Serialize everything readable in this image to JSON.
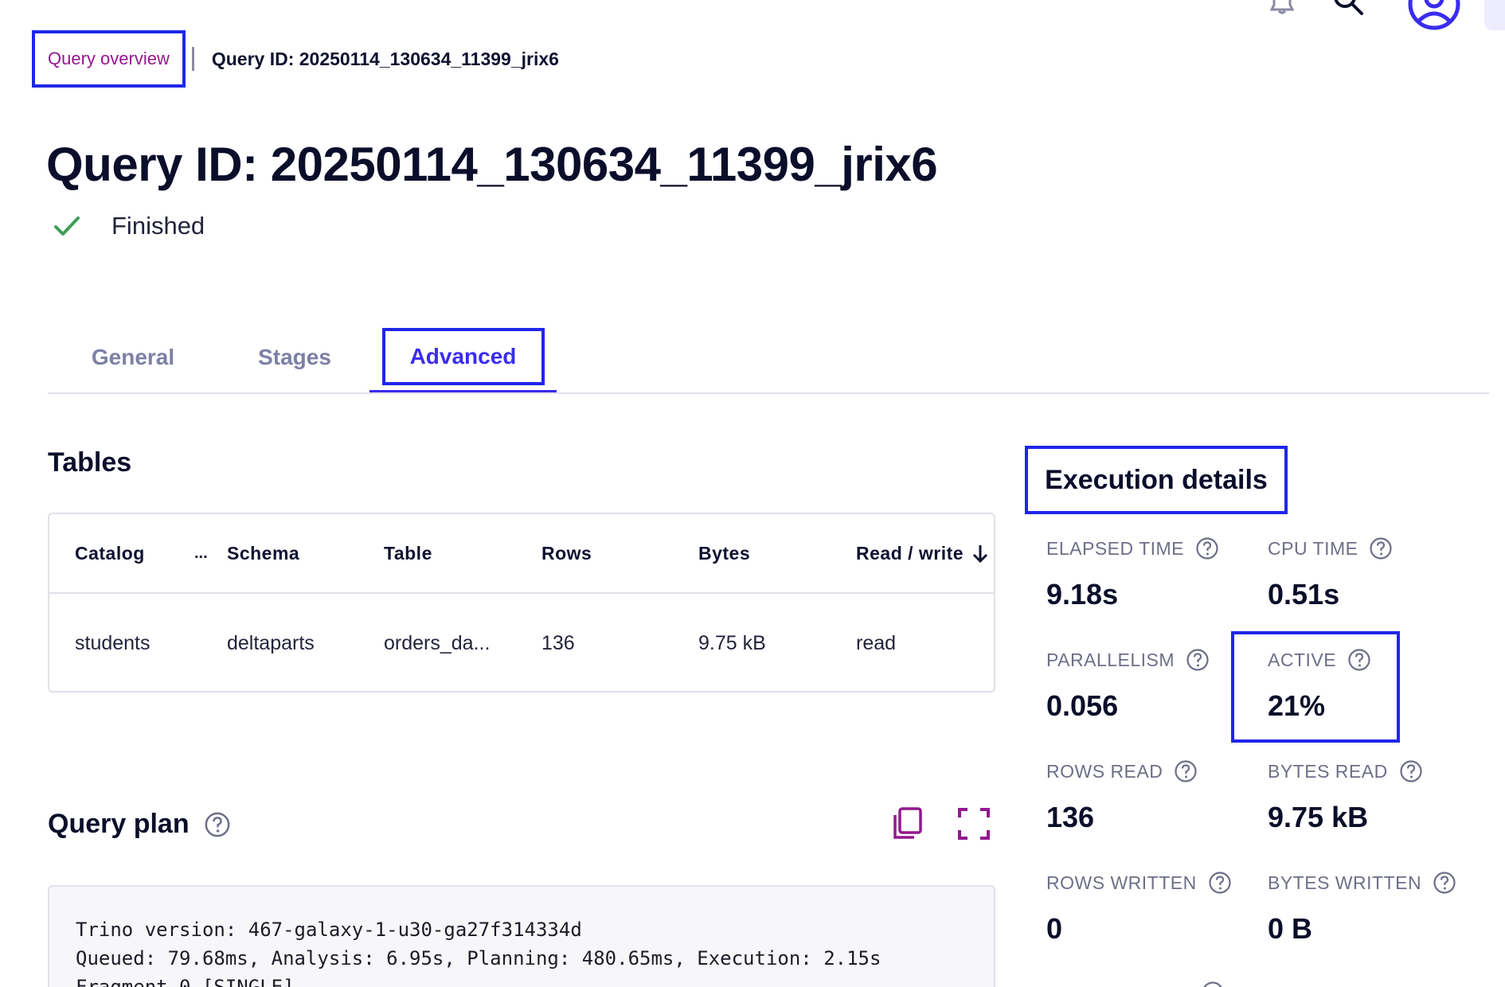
{
  "breadcrumb": {
    "link_label": "Query overview",
    "current": "Query ID: 20250114_130634_11399_jrix6"
  },
  "header": {
    "title": "Query ID: 20250114_130634_11399_jrix6",
    "status": "Finished"
  },
  "tabs": [
    {
      "label": "General",
      "active": false
    },
    {
      "label": "Stages",
      "active": false
    },
    {
      "label": "Advanced",
      "active": true
    }
  ],
  "tables": {
    "title": "Tables",
    "columns": [
      "Catalog",
      "Schema",
      "Table",
      "Rows",
      "Bytes",
      "Read / write"
    ],
    "column_menu": "...",
    "rows": [
      [
        "students",
        "deltaparts",
        "orders_da...",
        "136",
        "9.75 kB",
        "read"
      ]
    ]
  },
  "query_plan": {
    "title": "Query plan",
    "lines": [
      "Trino version: 467-galaxy-1-u30-ga27f314334d",
      "Queued: 79.68ms, Analysis: 6.95s, Planning: 480.65ms, Execution: 2.15s",
      "Fragment 0 [SINGLE]"
    ]
  },
  "execution": {
    "title": "Execution details",
    "metrics": [
      {
        "label": "ELAPSED TIME",
        "value": "9.18s"
      },
      {
        "label": "CPU TIME",
        "value": "0.51s"
      },
      {
        "label": "PARALLELISM",
        "value": "0.056"
      },
      {
        "label": "ACTIVE",
        "value": "21%"
      },
      {
        "label": "ROWS READ",
        "value": "136"
      },
      {
        "label": "BYTES READ",
        "value": "9.75 kB"
      },
      {
        "label": "ROWS WRITTEN",
        "value": "0"
      },
      {
        "label": "BYTES WRITTEN",
        "value": "0 B"
      }
    ]
  },
  "colors": {
    "accent": "#3a2cf0",
    "link": "#94178f",
    "highlight_border": "#1f26e8",
    "success": "#3f9e57",
    "text_primary": "#0b0e2a",
    "text_muted": "#6d6f88",
    "border": "#e1e1ea"
  },
  "icons": {
    "top_bar": [
      "bell-icon",
      "search-icon",
      "user-avatar-icon"
    ],
    "status": "check-icon",
    "help": "help-circle-icon",
    "sort": "arrow-down-icon",
    "plan_actions": [
      "copy-icon",
      "fullscreen-icon"
    ]
  }
}
